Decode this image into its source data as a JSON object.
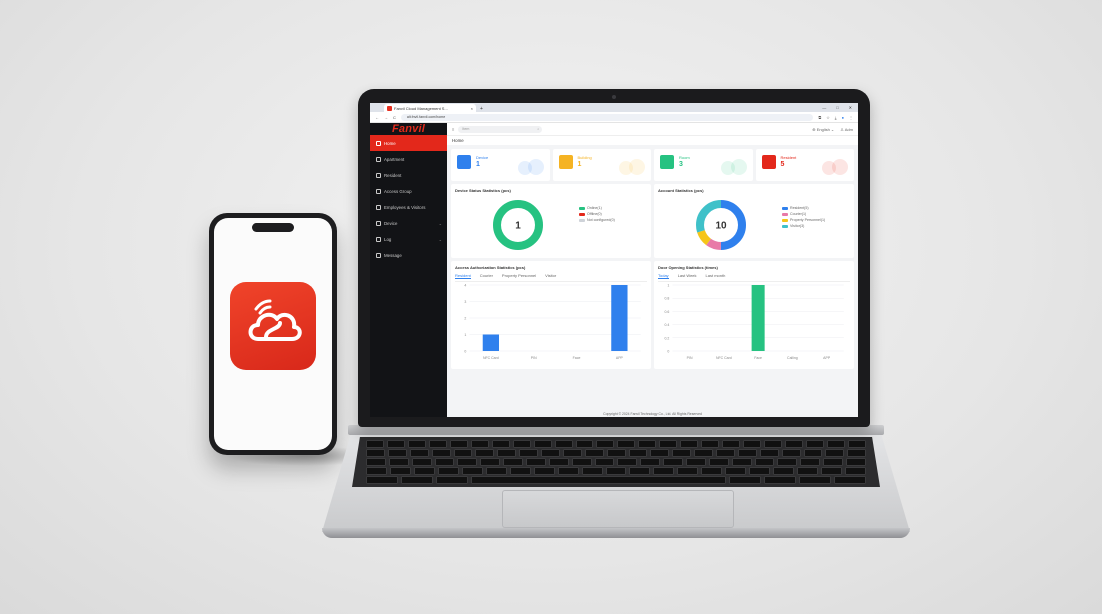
{
  "browser": {
    "tab_title": "Fanvil Cloud Management S...",
    "tab_close": "×",
    "tab_new": "+",
    "url": "alt.fnvil.fanvil.com/home",
    "nav_back": "←",
    "nav_forward": "→",
    "nav_reload": "C"
  },
  "sidebar": {
    "logo": "Fanvil",
    "items": [
      {
        "label": "Home",
        "active": true
      },
      {
        "label": "Apartment"
      },
      {
        "label": "Resident"
      },
      {
        "label": "Access Group"
      },
      {
        "label": "Employees & Visitors"
      },
      {
        "label": "Device",
        "caret": "⌄"
      },
      {
        "label": "Log",
        "caret": "⌄"
      },
      {
        "label": "Message"
      }
    ]
  },
  "topbar": {
    "search_placeholder": "Item",
    "language": "English",
    "user": "Adm"
  },
  "breadcrumb": "Home",
  "cards": [
    {
      "label": "Device",
      "value": "1",
      "color": "#2f80ed"
    },
    {
      "label": "Building",
      "value": "1",
      "color": "#f5b323"
    },
    {
      "label": "Room",
      "value": "3",
      "color": "#26c281"
    },
    {
      "label": "Resident",
      "value": "5",
      "color": "#e3281b"
    }
  ],
  "device_status": {
    "title": "Device Status Statistics (pcs)",
    "total": "1",
    "legend": [
      {
        "label": "Online(1)",
        "color": "#26c281"
      },
      {
        "label": "Offline(0)",
        "color": "#e3281b"
      },
      {
        "label": "Not configured(0)",
        "color": "#cfd3d9"
      }
    ],
    "segments": [
      1,
      0,
      0
    ]
  },
  "account_stats": {
    "title": "Account Statistics (pcs)",
    "total": "10",
    "legend": [
      {
        "label": "Resident(5)",
        "color": "#2f80ed"
      },
      {
        "label": "Courier(1)",
        "color": "#e87aa8"
      },
      {
        "label": "Property Personnel(1)",
        "color": "#f5c518"
      },
      {
        "label": "Visitor(3)",
        "color": "#3fc1c9"
      }
    ],
    "segments": [
      5,
      1,
      1,
      3
    ]
  },
  "access_auth": {
    "title": "Access Authorization Statistics (pcs)",
    "tabs": [
      "Resident",
      "Courier",
      "Property Personnel",
      "Visitor"
    ],
    "active_tab": 0
  },
  "door_opening": {
    "title": "Door Opening Statistics (times)",
    "tabs": [
      "Today",
      "Last Week",
      "Last month"
    ],
    "active_tab": 0
  },
  "chart_data": [
    {
      "type": "bar",
      "categories": [
        "NFC Card",
        "PIN",
        "Face",
        "APP"
      ],
      "values": [
        1,
        0,
        0,
        4
      ],
      "ylim": [
        0,
        4
      ],
      "yticks": [
        0,
        1,
        2,
        3,
        4
      ],
      "color": "#2f80ed"
    },
    {
      "type": "bar",
      "categories": [
        "PIN",
        "NFC Card",
        "Face",
        "Calling",
        "APP"
      ],
      "values": [
        0,
        0,
        1,
        0,
        0
      ],
      "ylim": [
        0,
        1
      ],
      "yticks": [
        0,
        0.2,
        0.4,
        0.6,
        0.8,
        1
      ],
      "color": "#26c281"
    }
  ],
  "footer": "Copyright © 2024 Fanvil Technology Co., Ltd. All Rights Reserved"
}
